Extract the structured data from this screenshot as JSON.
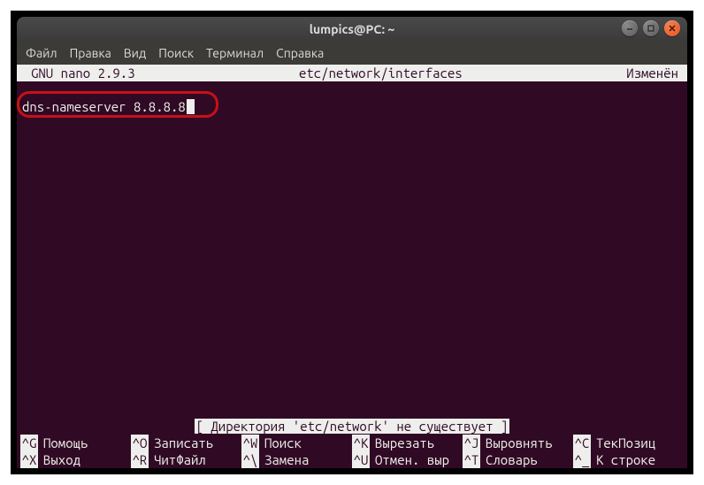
{
  "titlebar": {
    "title": "lumpics@PC: ~"
  },
  "menubar": {
    "items": [
      "Файл",
      "Правка",
      "Вид",
      "Поиск",
      "Терминал",
      "Справка"
    ]
  },
  "nano": {
    "version": "GNU nano 2.9.3",
    "file": "etc/network/interfaces",
    "status": "Изменён",
    "content": "dns-nameserver 8.8.8.8",
    "message": "[ Директория 'etc/network' не существует ]"
  },
  "shortcuts": [
    {
      "key": "^G",
      "label": "Помощь"
    },
    {
      "key": "^O",
      "label": "Записать"
    },
    {
      "key": "^W",
      "label": "Поиск"
    },
    {
      "key": "^K",
      "label": "Вырезать"
    },
    {
      "key": "^J",
      "label": "Выровнять"
    },
    {
      "key": "^C",
      "label": "ТекПозиц"
    },
    {
      "key": "^X",
      "label": "Выход"
    },
    {
      "key": "^R",
      "label": "ЧитФайл"
    },
    {
      "key": "^\\",
      "label": "Замена"
    },
    {
      "key": "^U",
      "label": "Отмен. выр"
    },
    {
      "key": "^T",
      "label": "Словарь"
    },
    {
      "key": "^_",
      "label": "К строке"
    }
  ]
}
